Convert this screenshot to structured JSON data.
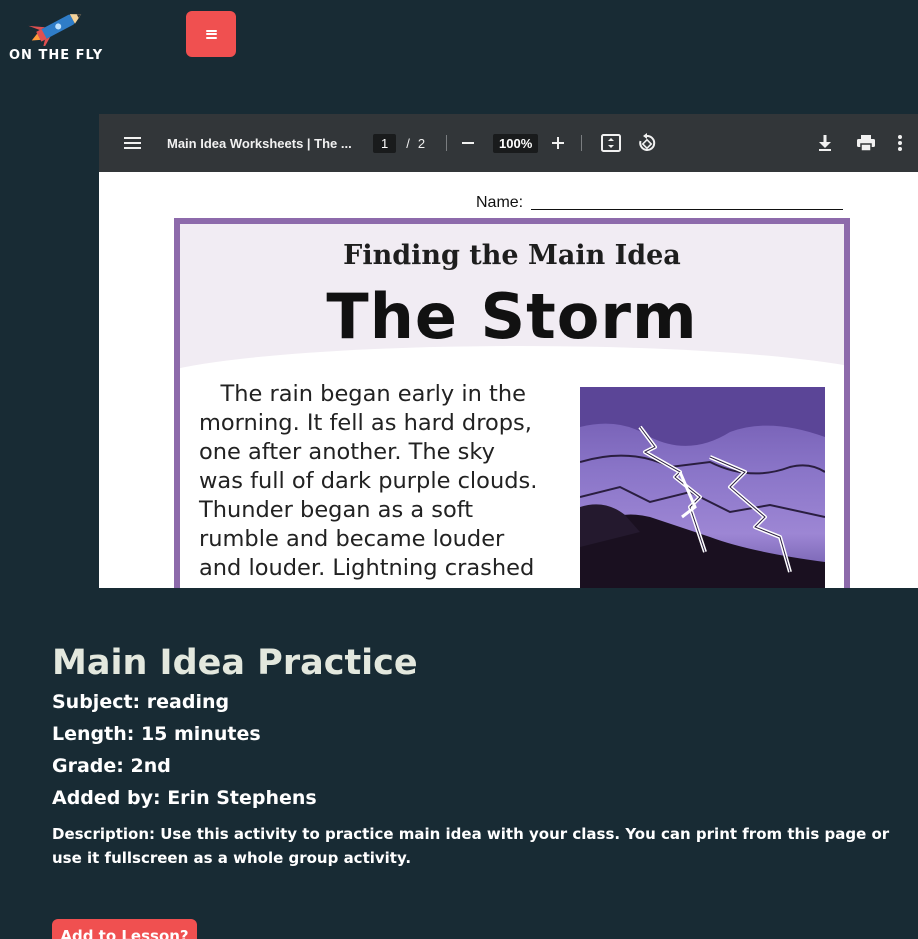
{
  "header": {
    "logo_text": "ON THE FLY",
    "menu_icon": "hamburger-icon",
    "menu_button_color": "#f05050"
  },
  "pdf_viewer": {
    "doc_title": "Main Idea Worksheets | The ...",
    "current_page": "1",
    "page_separator": "/",
    "total_pages": "2",
    "zoom_minus": "—",
    "zoom": "100%",
    "zoom_plus": "+",
    "icons": [
      "menu-icon",
      "fit-page-icon",
      "rotate-icon",
      "download-icon",
      "print-icon",
      "more-vert-icon"
    ]
  },
  "worksheet": {
    "name_label": "Name:",
    "heading": "Finding the Main Idea",
    "title": "The Storm",
    "story_lines": [
      "   The rain began early in the",
      "morning. It fell as hard drops,",
      "one after another. The sky",
      "was full of dark purple clouds.",
      "Thunder began as a soft",
      "rumble and became louder",
      "and louder. Lightning crashed"
    ],
    "frame_color": "#8d6aab"
  },
  "lesson": {
    "title": "Main Idea Practice",
    "subject": "Subject: reading",
    "length": "Length: 15 minutes",
    "grade": "Grade: 2nd",
    "added_by": "Added by: Erin Stephens",
    "description": "Description: Use this activity to practice main idea with your class. You can print from this page or use it fullscreen as a whole group activity.",
    "add_button": "Add to Lesson?"
  },
  "colors": {
    "background": "#182b34",
    "accent": "#f05050",
    "toolbar": "#323639"
  }
}
